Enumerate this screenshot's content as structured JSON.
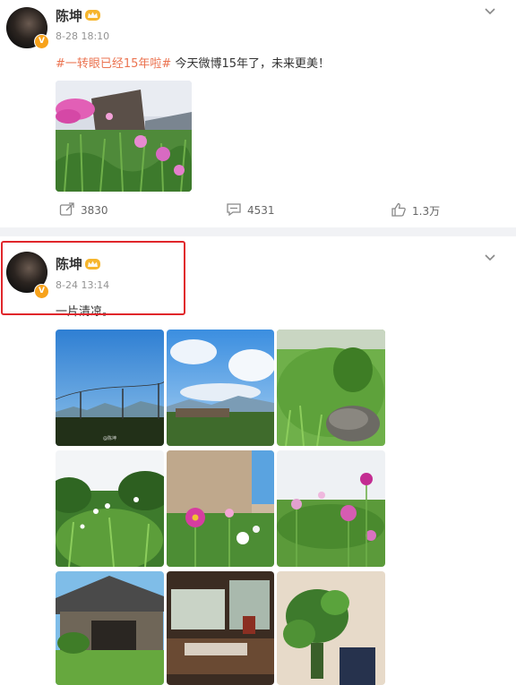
{
  "posts": [
    {
      "author": "陈坤",
      "time": "8-28 18:10",
      "topic": "#一转眼已经15年啦#",
      "text": " 今天微博15年了，未来更美！",
      "actions": {
        "repost": "3830",
        "comment": "4531",
        "like": "1.3万"
      }
    },
    {
      "author": "陈坤",
      "time": "8-24 13:14",
      "text": "一片清凉。"
    }
  ],
  "photo_watermark": "@陈坤",
  "icons": {
    "vip_crown": "crown-icon",
    "verified": "verified-badge-icon",
    "more": "chevron-down-icon",
    "repost": "repost-icon",
    "comment": "comment-icon",
    "like": "like-icon"
  },
  "colors": {
    "topic": "#eb7350",
    "verified_badge": "#f7a21b",
    "highlight_box": "#e0262b",
    "page_background": "#f1f2f5"
  }
}
